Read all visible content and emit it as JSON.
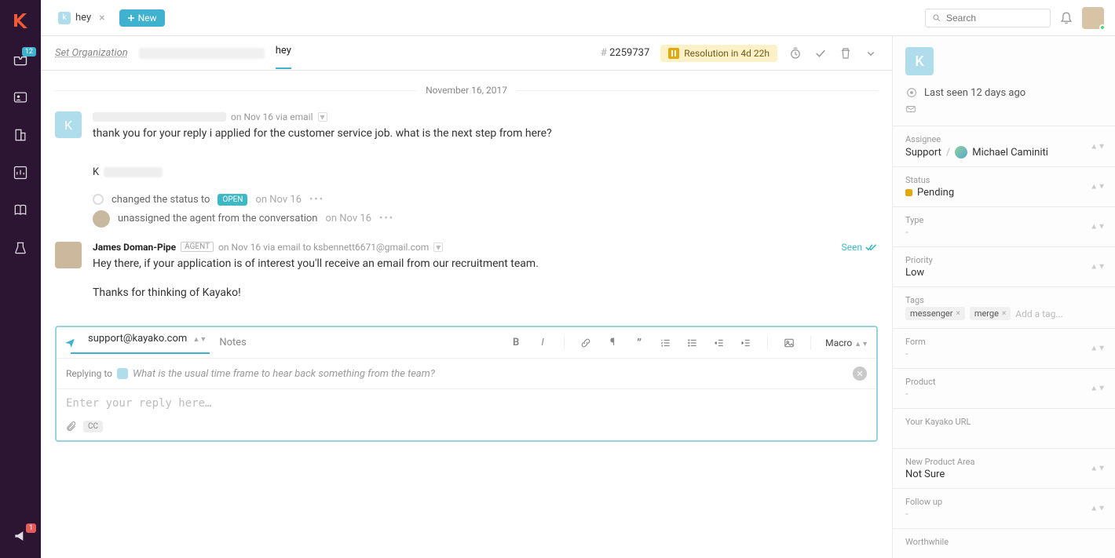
{
  "header": {
    "tab_title": "hey",
    "tab_initial": "k",
    "new_label": "New",
    "search_placeholder": "Search"
  },
  "leftbar": {
    "inbox_badge": "12",
    "announce_badge": "1"
  },
  "case": {
    "set_org": "Set Organization",
    "subject": "hey",
    "id_hash": "#",
    "id": "2259737",
    "sla_text": "Resolution in 4d 22h"
  },
  "conv": {
    "date": "November 16, 2017",
    "msg1": {
      "on": "on Nov 16 via email",
      "body": "thank you for your reply i applied for the customer service job. what is the next step from here?",
      "sig_initial": "K"
    },
    "event1": {
      "text": "changed the status to",
      "pill": "OPEN",
      "date": "on Nov 16"
    },
    "event2": {
      "text": "unassigned the agent from the conversation",
      "date": "on Nov 16"
    },
    "msg2": {
      "name": "James Doman-Pipe",
      "agent_badge": "AGENT",
      "on": "on Nov 16 via email to ksbennett6671@gmail.com",
      "body1": "Hey there, if your application is of interest you'll receive an email from our recruitment team.",
      "body2": "Thanks for thinking of Kayako!",
      "seen": "Seen"
    }
  },
  "composer": {
    "from": "support@kayako.com",
    "notes": "Notes",
    "macro": "Macro",
    "replying_to_label": "Replying to",
    "quote": "What is the usual time frame to hear back something from the team?",
    "placeholder": "Enter your reply here…",
    "cc": "CC"
  },
  "sidebar": {
    "initial": "K",
    "last_seen": "Last seen 12 days ago",
    "assignee_label": "Assignee",
    "assignee_team": "Support",
    "assignee_sep": "/",
    "assignee_name": "Michael Caminiti",
    "status_label": "Status",
    "status_value": "Pending",
    "type_label": "Type",
    "type_value": "-",
    "priority_label": "Priority",
    "priority_value": "Low",
    "tags_label": "Tags",
    "tag1": "messenger",
    "tag2": "merge",
    "add_tag": "Add a tag...",
    "form_label": "Form",
    "product_label": "Product",
    "url_label": "Your Kayako URL",
    "newarea_label": "New Product Area",
    "newarea_value": "Not Sure",
    "followup_label": "Follow up",
    "worthwhile_label": "Worthwhile",
    "dash": "-"
  }
}
